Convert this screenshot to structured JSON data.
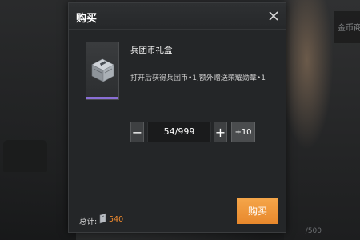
{
  "background": {
    "right_panel_text": "金币商",
    "bottom_counter": "/500"
  },
  "modal": {
    "title": "购买",
    "close_icon": "close-icon",
    "item": {
      "icon": "supply-box-icon",
      "rarity_color": "#8a6fd6",
      "name": "兵团币礼盒",
      "description": "打开后获得兵团币•1,额外赠送荣耀勋章•1"
    },
    "quantity": {
      "minus_label": "−",
      "value": "54/999",
      "plus_label": "+",
      "plus10_label": "+10"
    },
    "footer": {
      "total_label": "总计:",
      "currency_icon": "token-icon",
      "total_value": "540",
      "total_color": "#f08a2e",
      "buy_label": "购买",
      "buy_color": "#ee9438"
    }
  }
}
